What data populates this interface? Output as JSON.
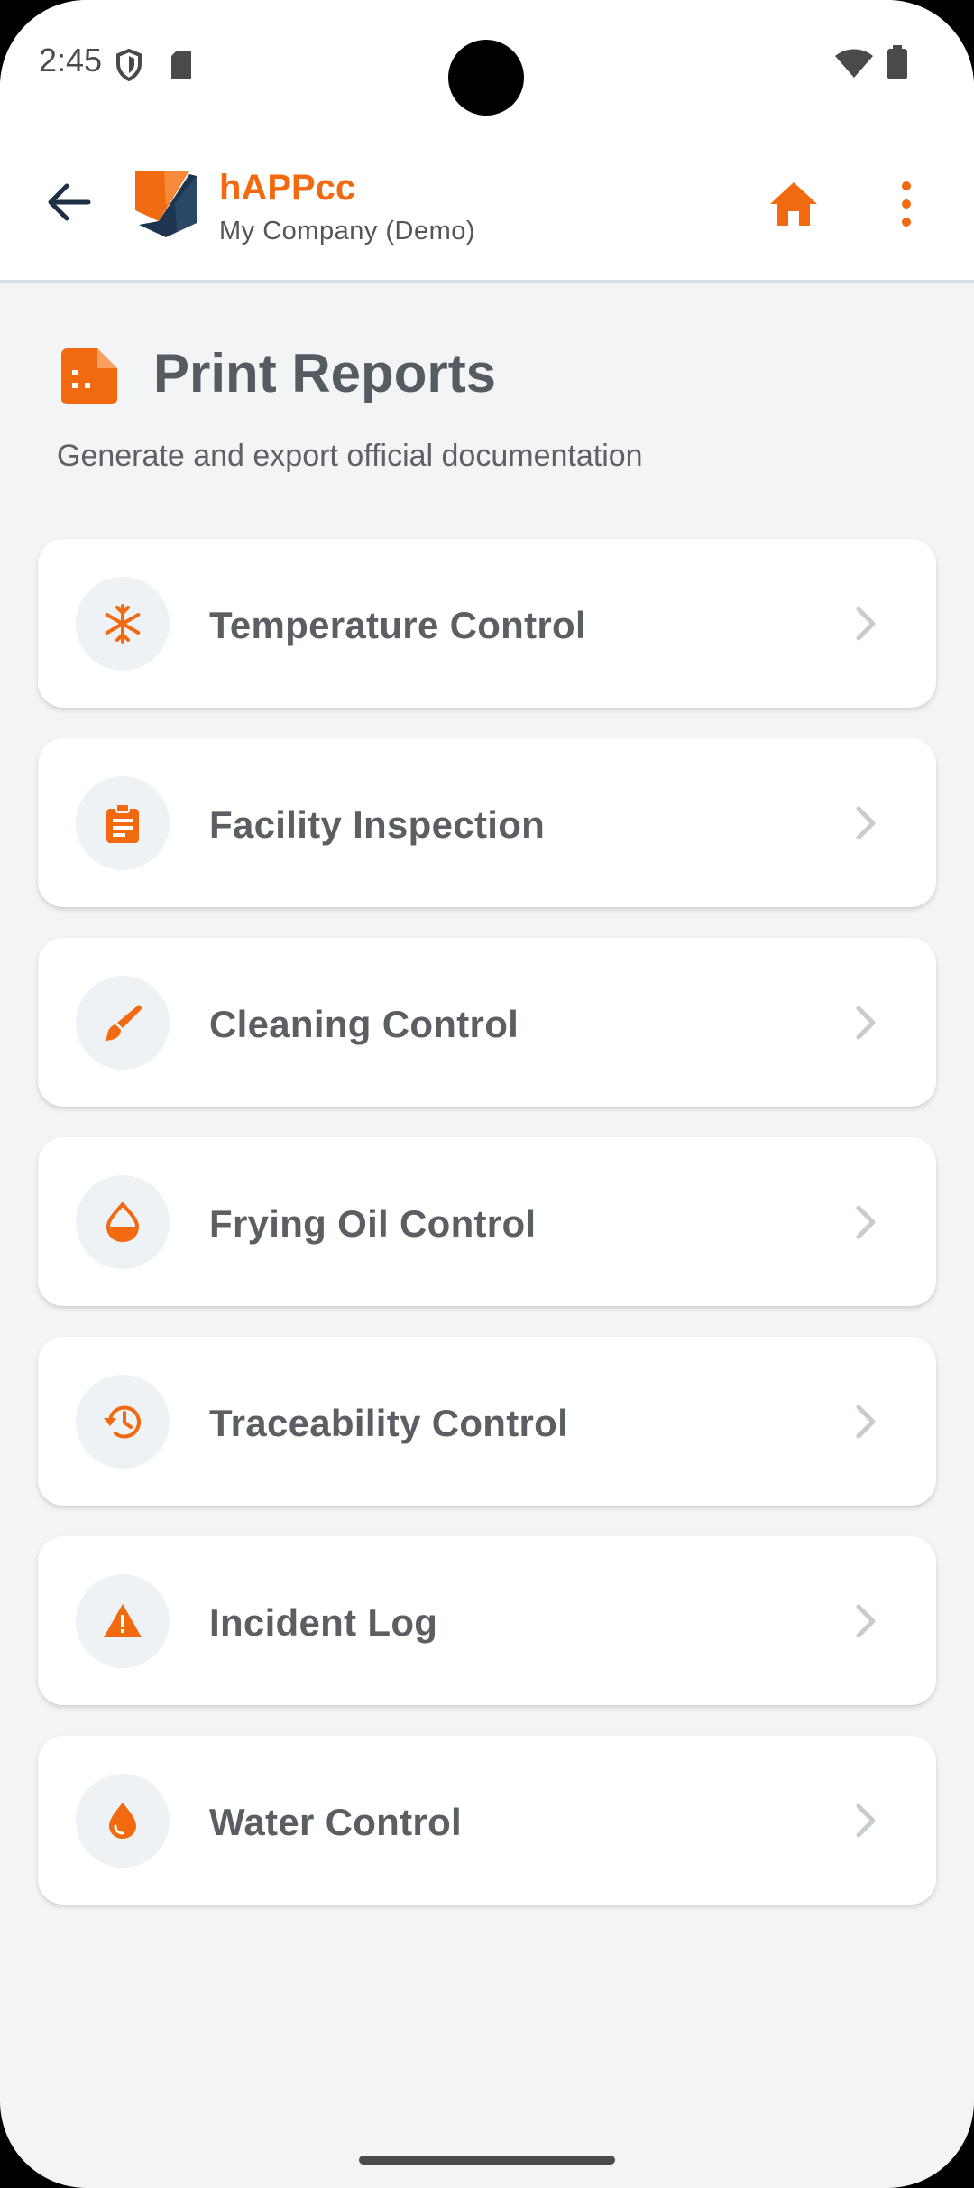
{
  "status_bar": {
    "time": "2:45"
  },
  "app_bar": {
    "app_name": "hAPPcc",
    "company": "My Company (Demo)"
  },
  "header": {
    "title": "Print Reports",
    "subtitle": "Generate and export official documentation"
  },
  "reports": [
    {
      "label": "Temperature Control",
      "icon": "snowflake-icon"
    },
    {
      "label": "Facility Inspection",
      "icon": "clipboard-icon"
    },
    {
      "label": "Cleaning Control",
      "icon": "brush-icon"
    },
    {
      "label": "Frying Oil Control",
      "icon": "oil-drop-icon"
    },
    {
      "label": "Traceability Control",
      "icon": "history-icon"
    },
    {
      "label": "Incident Log",
      "icon": "warning-icon"
    },
    {
      "label": "Water Control",
      "icon": "water-drop-icon"
    }
  ],
  "colors": {
    "accent": "#f26a10",
    "logo_dark": "#1e3550",
    "background": "#f2f4f6"
  }
}
